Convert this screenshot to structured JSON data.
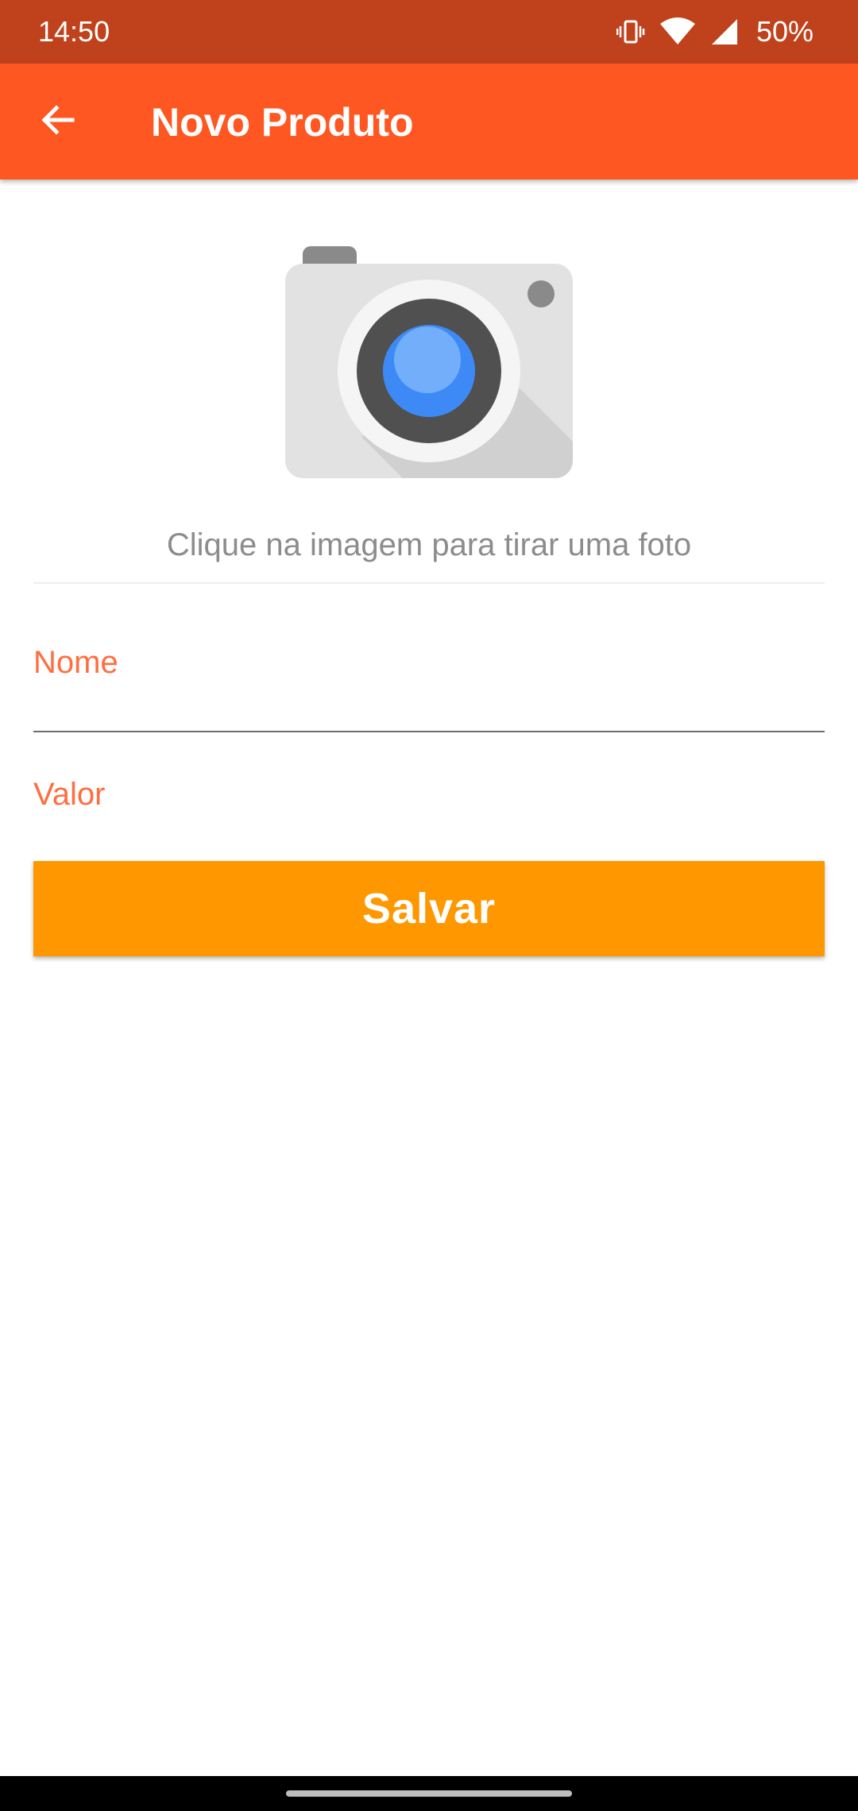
{
  "status_bar": {
    "time": "14:50",
    "battery": "50%",
    "icons": [
      "vibrate-icon",
      "wifi-icon",
      "signal-icon"
    ]
  },
  "app_bar": {
    "title": "Novo Produto",
    "back_icon": "arrow-back-icon"
  },
  "photo": {
    "icon": "camera-icon",
    "hint": "Clique na imagem para tirar uma foto"
  },
  "form": {
    "nome_label": "Nome",
    "valor_label": "Valor",
    "save_label": "Salvar"
  },
  "colors": {
    "status_bar": "#BF421C",
    "app_bar": "#FF5722",
    "field_label": "#FF6E40",
    "button": "#FF9800"
  }
}
